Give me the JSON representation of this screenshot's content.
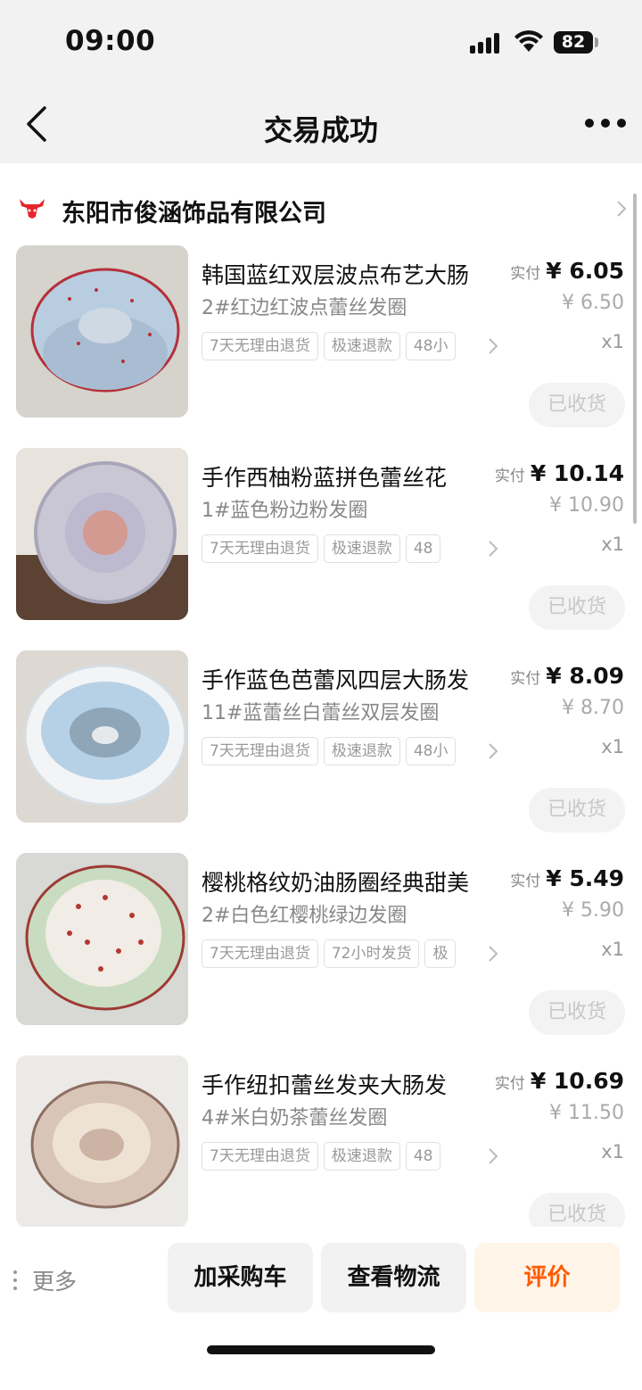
{
  "status_bar": {
    "time": "09:00",
    "battery": "82"
  },
  "nav": {
    "title": "交易成功"
  },
  "shop": {
    "name": "东阳市俊涵饰品有限公司"
  },
  "items": [
    {
      "title": "韩国蓝红双层波点布艺大肠",
      "spec": "2#红边红波点蕾丝发圈",
      "tags": [
        "7天无理由退货",
        "极速退款",
        "48小"
      ],
      "price_label": "实付",
      "price": "¥ 6.05",
      "original_price": "¥ 6.50",
      "qty": "x1",
      "status_button": "已收货"
    },
    {
      "title": "手作西柚粉蓝拼色蕾丝花",
      "spec": "1#蓝色粉边粉发圈",
      "tags": [
        "7天无理由退货",
        "极速退款",
        "48"
      ],
      "price_label": "实付",
      "price": "¥ 10.14",
      "original_price": "¥ 10.90",
      "qty": "x1",
      "status_button": "已收货"
    },
    {
      "title": "手作蓝色芭蕾风四层大肠发",
      "spec": "11#蓝蕾丝白蕾丝双层发圈",
      "tags": [
        "7天无理由退货",
        "极速退款",
        "48小"
      ],
      "price_label": "实付",
      "price": "¥ 8.09",
      "original_price": "¥ 8.70",
      "qty": "x1",
      "status_button": "已收货"
    },
    {
      "title": "樱桃格纹奶油肠圈经典甜美",
      "spec": "2#白色红樱桃绿边发圈",
      "tags": [
        "7天无理由退货",
        "72小时发货",
        "极"
      ],
      "price_label": "实付",
      "price": "¥ 5.49",
      "original_price": "¥ 5.90",
      "qty": "x1",
      "status_button": "已收货"
    },
    {
      "title": "手作纽扣蕾丝发夹大肠发",
      "spec": "4#米白奶茶蕾丝发圈",
      "tags": [
        "7天无理由退货",
        "极速退款",
        "48"
      ],
      "price_label": "实付",
      "price": "¥ 10.69",
      "original_price": "¥ 11.50",
      "qty": "x1",
      "status_button": "已收货"
    }
  ],
  "bottom_bar": {
    "more_label": "更多",
    "add_cart": "加采购车",
    "track": "查看物流",
    "review": "评价"
  },
  "colors": {
    "accent": "#ff5a00",
    "shop_logo": "#e5242b"
  }
}
